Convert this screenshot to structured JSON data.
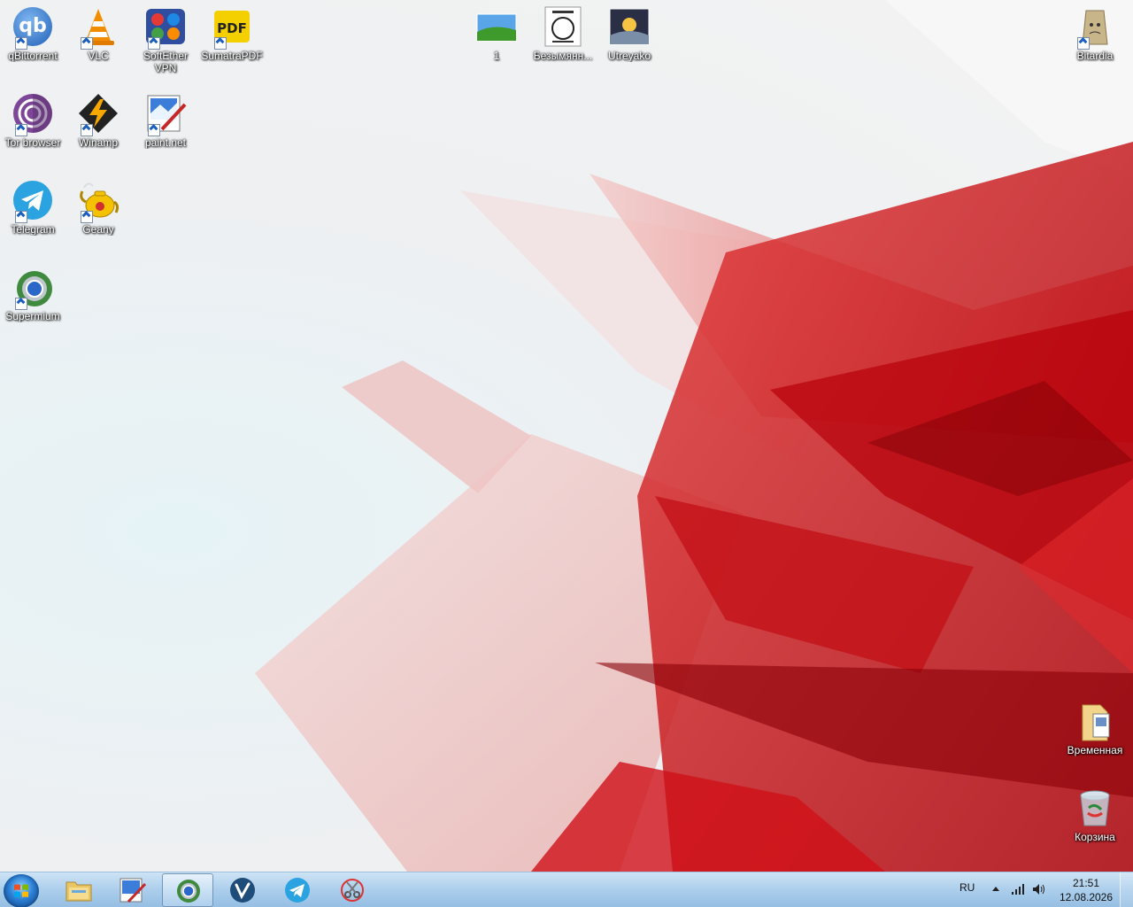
{
  "desktop": {
    "icons": [
      {
        "label": "qBittorrent"
      },
      {
        "label": "VLC"
      },
      {
        "label": "SoftEther VPN"
      },
      {
        "label": "SumatraPDF"
      },
      {
        "label": "Tor browser"
      },
      {
        "label": "Winamp"
      },
      {
        "label": "paint.net"
      },
      {
        "label": "Telegram"
      },
      {
        "label": "Geany"
      },
      {
        "label": "Supermium"
      },
      {
        "label": "1"
      },
      {
        "label": "Безымянн..."
      },
      {
        "label": "Utreyako"
      },
      {
        "label": "Bitardia"
      },
      {
        "label": "Временная"
      },
      {
        "label": "Корзина"
      }
    ]
  },
  "taskbar": {
    "pinned": [
      {
        "icon": "windows-explorer-icon"
      },
      {
        "icon": "paint-net-icon"
      },
      {
        "icon": "supermium-icon",
        "active": true
      },
      {
        "icon": "vivaldi-icon"
      },
      {
        "icon": "telegram-icon"
      },
      {
        "icon": "snipping-tool-icon"
      }
    ],
    "tray": {
      "language": "RU",
      "time": "21:51",
      "date": "12.08.2026"
    }
  },
  "colors": {
    "accent_red": "#c8101a",
    "taskbar": "#a9cbe8"
  }
}
